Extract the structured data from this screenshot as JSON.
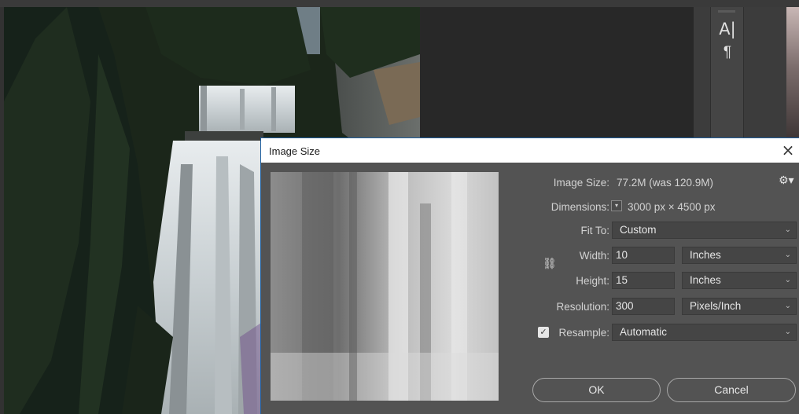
{
  "dialog": {
    "title": "Image Size",
    "close_label": "×",
    "image_size_label": "Image Size:",
    "image_size_value": "77.2M (was 120.9M)",
    "dimensions_label": "Dimensions:",
    "dimensions_value": "3000 px  ×  4500 px",
    "fit_to_label": "Fit To:",
    "fit_to_value": "Custom",
    "width_label": "Width:",
    "width_value": "10",
    "width_unit": "Inches",
    "height_label": "Height:",
    "height_value": "15",
    "height_unit": "Inches",
    "resolution_label": "Resolution:",
    "resolution_value": "300",
    "resolution_unit": "Pixels/Inch",
    "resample_label": "Resample:",
    "resample_checked": true,
    "resample_value": "Automatic",
    "ok_label": "OK",
    "cancel_label": "Cancel"
  },
  "tools": {
    "character_glyph": "A|",
    "paragraph_glyph": "¶"
  },
  "icons": {
    "gear": "gear-icon",
    "link": "chain-link-icon",
    "close": "close-icon",
    "dropdown": "chevron-down-icon"
  },
  "colors": {
    "dialog_bg": "#535353",
    "field_bg": "#454545",
    "titlebar_bg": "#ffffff",
    "accent_border": "#1f5f9e"
  }
}
